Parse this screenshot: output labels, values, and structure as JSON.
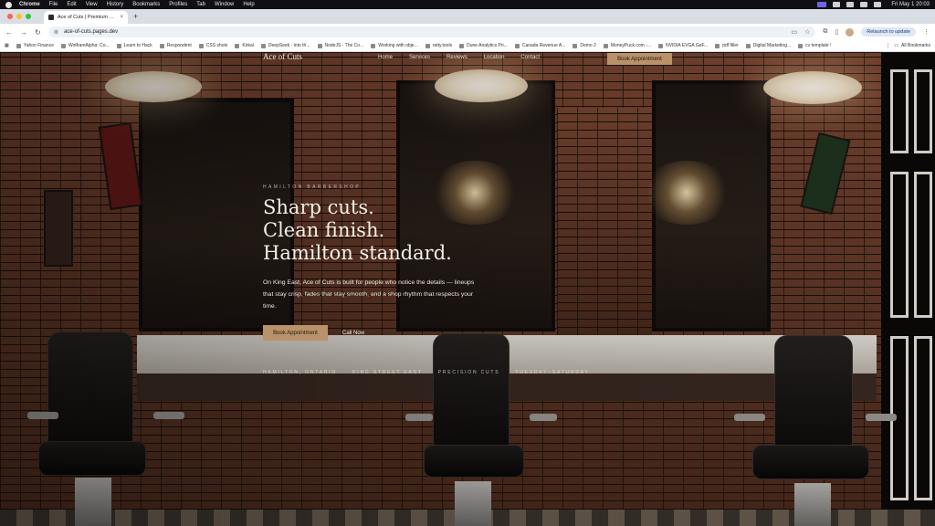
{
  "menubar": {
    "app": "Chrome",
    "items": [
      "File",
      "Edit",
      "View",
      "History",
      "Bookmarks",
      "Profiles",
      "Tab",
      "Window",
      "Help"
    ],
    "clock": "Fri May 1  20:03"
  },
  "tab": {
    "title": "Ace of Cuts | Premium Barber",
    "close": "×"
  },
  "new_tab": "+",
  "toolbar": {
    "url": "ace-of-cuts.pages.dev",
    "relaunch": "Relaunch to update",
    "back": "←",
    "forward": "→",
    "reload": "↻"
  },
  "bookmarks": {
    "items": [
      "Yahoo Finance",
      "WolframAlpha: Co...",
      "Learn to Hack",
      "Respondent",
      "CSS shots",
      "Kirkal",
      "DeepSeek - into th...",
      "NodeJS - The Co...",
      "Working with obje...",
      "ratty.tools",
      "Dune Analytics Pri...",
      "Canada Revenue A...",
      "Demo 2",
      "MoneyPuck.com -...",
      "NVIDIA EVGA GeF...",
      "pdf filler",
      "Digital Marketing...",
      "cv template !"
    ],
    "all": "All Bookmarks"
  },
  "site": {
    "brand": "Ace of Cuts",
    "nav": [
      "Home",
      "Services",
      "Reviews",
      "Location",
      "Contact"
    ],
    "nav_cta": "Book Appointment"
  },
  "hero": {
    "eyebrow": "HAMILTON BARBERSHOP",
    "line1": "Sharp cuts.",
    "line2": "Clean finish.",
    "line3": "Hamilton standard.",
    "description": "On King East, Ace of Cuts is built for people who notice the details — lineups that stay crisp, fades that stay smooth, and a shop rhythm that respects your time.",
    "cta_primary": "Book Appointment",
    "cta_secondary": "Call Now",
    "tags": [
      "HAMILTON, ONTARIO",
      "KING STREET EAST",
      "PRECISION CUTS",
      "TUESDAY–SATURDAY"
    ]
  }
}
